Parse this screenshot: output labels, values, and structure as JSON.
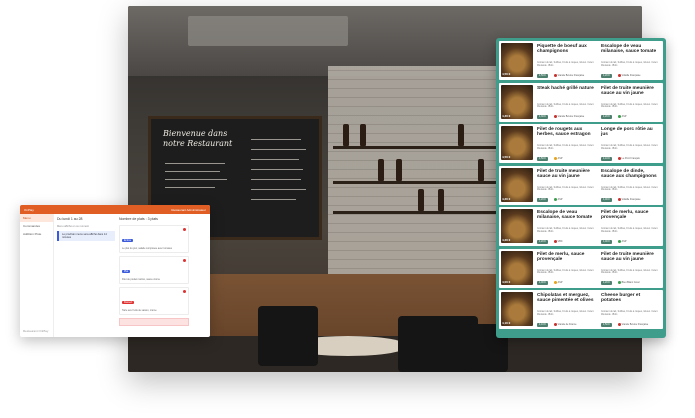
{
  "admin": {
    "app_name": "OnPlay",
    "account": "Restaurant Administrateur",
    "nav": [
      "Menu",
      "Commandes",
      "Addition Piste"
    ],
    "footer": "Restaurant OnPlay",
    "column1": {
      "title": "Du lundi 1 au 28",
      "sub": "Menu affiché en ce moment",
      "note": "Le prochain menu sera affiché dans 14 minutes"
    },
    "column2": {
      "title": "Nombre de plats : 3 plats",
      "cards": [
        {
          "tag": "Entrée",
          "color": "#3b5bdb",
          "text": "Le plat du jour, salade composée avec tomates"
        },
        {
          "tag": "Plat",
          "color": "#3b5bdb",
          "text": "Filet de poulet mariné, sauce crème"
        },
        {
          "tag": "Dessert",
          "color": "#e03131",
          "text": "Tarte aux fruits de saison, crème"
        }
      ]
    }
  },
  "menu": {
    "desc": "Contient du lait, Sulfites, Fruits à coques, Gluten. Céleri. Moutarde. Œufs",
    "rows": [
      {
        "left": {
          "title": "Piquette de boeuf aux champignons",
          "price": "4,50 €",
          "tag": "Viande Bovine Française",
          "dot": "#c9302c"
        },
        "right": {
          "title": "Escalope de veau milanaise, sauce tomate",
          "price": "4,20 €",
          "tag": "Volaille Française",
          "dot": "#c9302c"
        }
      },
      {
        "left": {
          "title": "Steak haché grillé nature",
          "price": "4,30 €",
          "tag": "Viande Bovine Française",
          "dot": "#c9302c"
        },
        "right": {
          "title": "Filet de truite meunière sauce au vin jaune",
          "price": "4,20 €",
          "tag": "ASP",
          "dot": "#3a9d4a"
        }
      },
      {
        "left": {
          "title": "Filet de rougets aux herbes, sauce estragon",
          "price": "4,50 €",
          "tag": "ASP",
          "dot": "#e8a317"
        },
        "right": {
          "title": "Longe de porc rôtie au jus",
          "price": "4,10 €",
          "tag": "Le Porc Français",
          "dot": "#c9302c"
        }
      },
      {
        "left": {
          "title": "Filet de truite meunière sauce au vin jaune",
          "price": "4,20 €",
          "tag": "ASP",
          "dot": "#3a9d4a"
        },
        "right": {
          "title": "Escalope de dinde, sauce aux champignons",
          "price": "4,00 €",
          "tag": "Volaille Française",
          "dot": "#c9302c"
        }
      },
      {
        "left": {
          "title": "Escalope de veau milanaise, sauce tomate",
          "price": "4,20 €",
          "tag": "VBC",
          "dot": "#c9302c"
        },
        "right": {
          "title": "Filet de merlu, sauce provençale",
          "price": "4,00 €",
          "tag": "ASP",
          "dot": "#3a9d4a"
        }
      },
      {
        "left": {
          "title": "Filet de merlu, sauce provençale",
          "price": "4,00 €",
          "tag": "ASP",
          "dot": "#e8a317"
        },
        "right": {
          "title": "Filet de truite meunière sauce au vin jaune",
          "price": "4,20 €",
          "tag": "Bleu Blanc Cœur",
          "dot": "#3a9d4a"
        }
      },
      {
        "left": {
          "title": "Chipolatas et merguez, sauce pimentée et olives",
          "price": "4,10 €",
          "tag": "Viande de France",
          "dot": "#c9302c"
        },
        "right": {
          "title": "Cheese burger et potatoes",
          "price": "4,50 €",
          "tag": "Viande Bovine Française",
          "dot": "#c9302c"
        }
      }
    ]
  },
  "board": {
    "heading": "Bienvenue dans notre Restaurant"
  }
}
